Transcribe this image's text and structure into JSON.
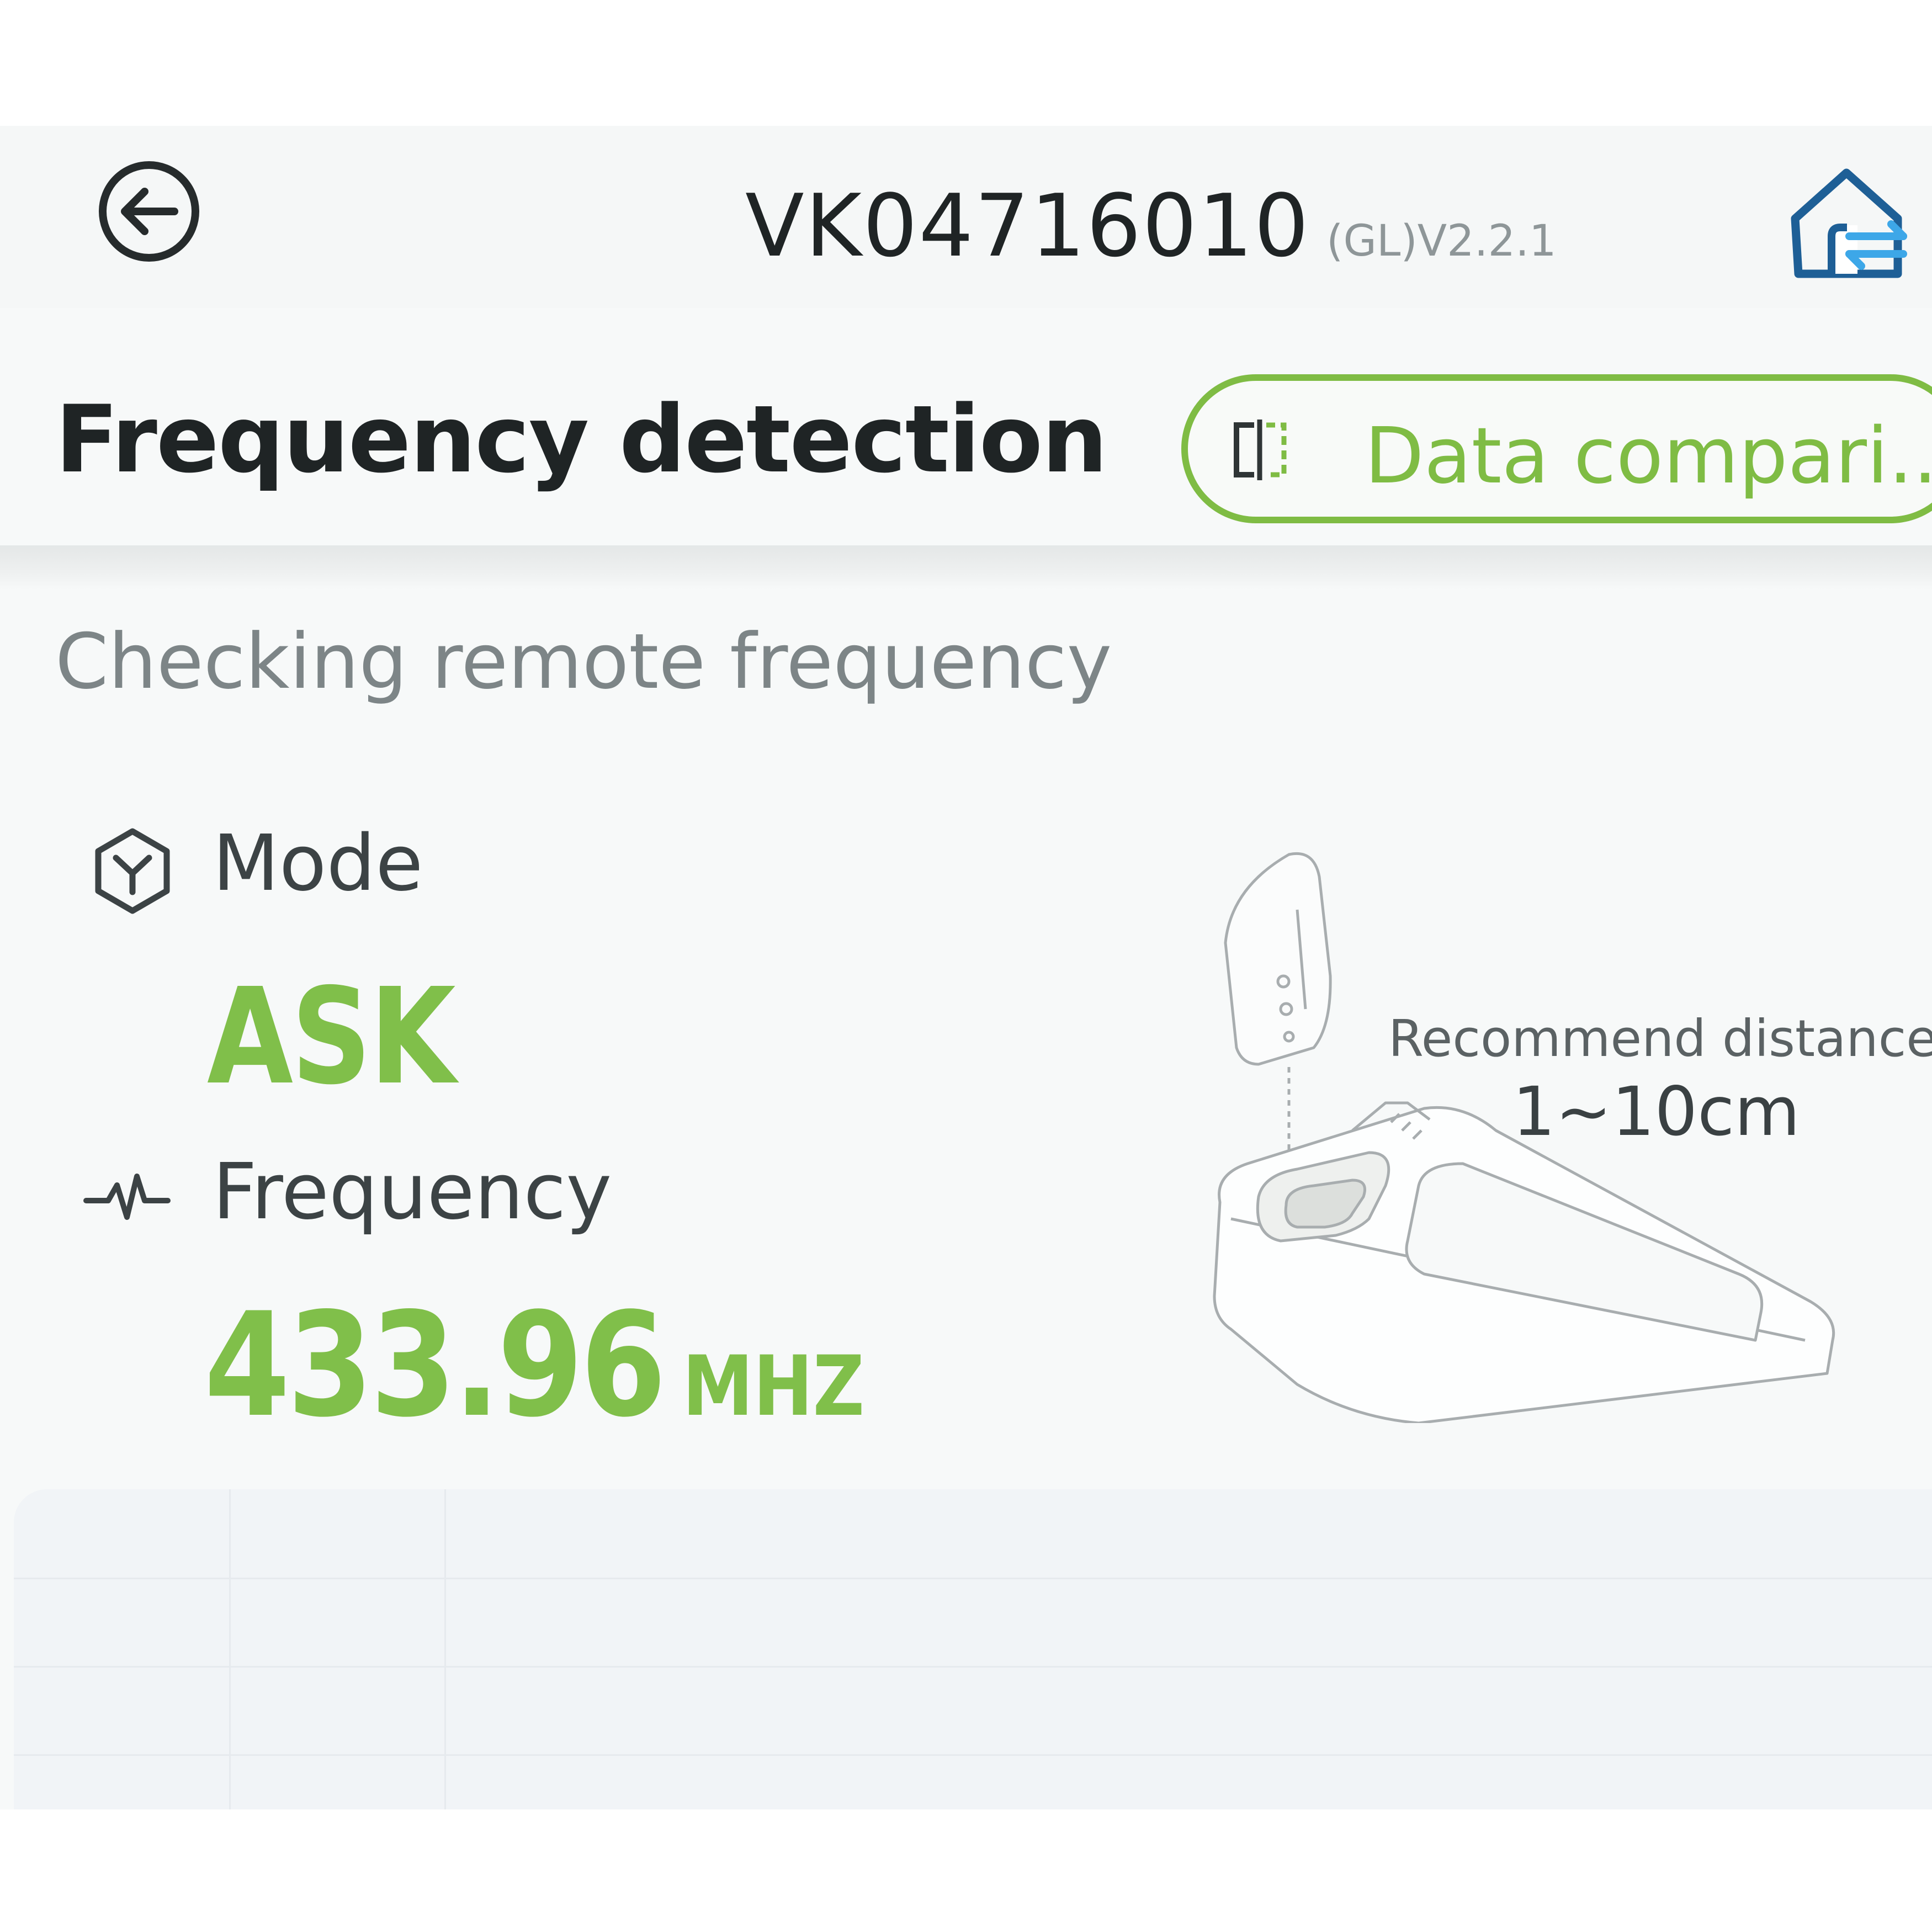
{
  "header": {
    "device_id": "VK04716010",
    "version": "(GL)V2.2.1",
    "back_icon": "back-arrow-icon",
    "home_icon": "home-switch-icon"
  },
  "page": {
    "title": "Frequency detection",
    "compare_button_label": "Data compari...",
    "compare_icon": "compare-icon",
    "status": "Checking remote frequency"
  },
  "mode": {
    "label": "Mode",
    "value": "ASK",
    "icon": "mode-icon"
  },
  "frequency": {
    "label": "Frequency",
    "value": "433.96",
    "unit": "MHZ",
    "icon": "waveform-icon"
  },
  "recommend": {
    "label": "Recommend distance",
    "value": "1~10cm"
  },
  "colors": {
    "accent": "#7fbc44",
    "text_dark": "#1f2425",
    "text_muted": "#7d8587"
  }
}
